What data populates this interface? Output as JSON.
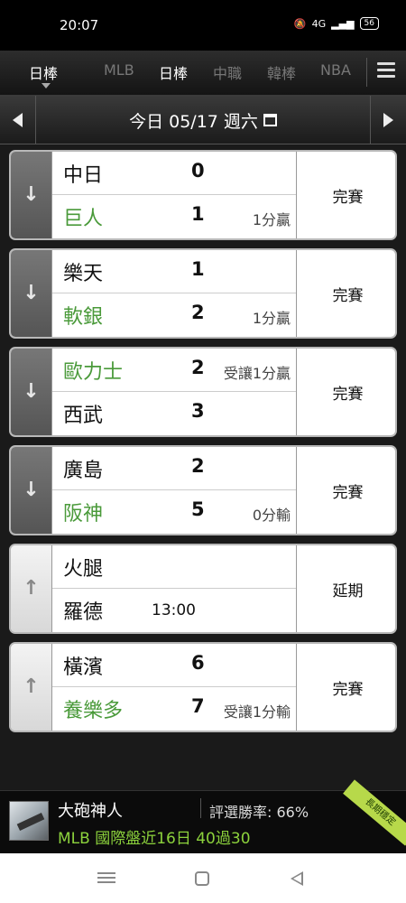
{
  "status_bar": {
    "time": "20:07",
    "network": "4G",
    "battery": "56"
  },
  "league_tabs": [
    {
      "label": "日棒",
      "active": true
    },
    {
      "label": "MLB",
      "active": false
    },
    {
      "label": "日棒",
      "active": false
    },
    {
      "label": "中職",
      "active": false
    },
    {
      "label": "韓棒",
      "active": false
    },
    {
      "label": "NBA",
      "active": false
    }
  ],
  "date_bar": {
    "label": "今日 05/17 週六"
  },
  "games": [
    {
      "arrow": "down",
      "status": "完賽",
      "away": {
        "name": "中日",
        "score": "0",
        "result": "",
        "highlight": false
      },
      "home": {
        "name": "巨人",
        "score": "1",
        "result": "1分贏",
        "highlight": true
      }
    },
    {
      "arrow": "down",
      "status": "完賽",
      "away": {
        "name": "樂天",
        "score": "1",
        "result": "",
        "highlight": false
      },
      "home": {
        "name": "軟銀",
        "score": "2",
        "result": "1分贏",
        "highlight": true
      }
    },
    {
      "arrow": "down",
      "status": "完賽",
      "away": {
        "name": "歐力士",
        "score": "2",
        "result": "受讓1分贏",
        "highlight": true
      },
      "home": {
        "name": "西武",
        "score": "3",
        "result": "",
        "highlight": false
      }
    },
    {
      "arrow": "down",
      "status": "完賽",
      "away": {
        "name": "廣島",
        "score": "2",
        "result": "",
        "highlight": false
      },
      "home": {
        "name": "阪神",
        "score": "5",
        "result": "0分輸",
        "highlight": true
      }
    },
    {
      "arrow": "up",
      "status": "延期",
      "away": {
        "name": "火腿",
        "score": "",
        "result": "",
        "highlight": false
      },
      "home": {
        "name": "羅德",
        "score": "",
        "result": "",
        "time": "13:00",
        "highlight": false
      }
    },
    {
      "arrow": "up",
      "status": "完賽",
      "away": {
        "name": "橫濱",
        "score": "6",
        "result": "",
        "highlight": false
      },
      "home": {
        "name": "養樂多",
        "score": "7",
        "result": "受讓1分輸",
        "highlight": true
      }
    }
  ],
  "banner": {
    "name": "大砲神人",
    "win_rate": "評選勝率: 66%",
    "record": "MLB 國際盤近16日 40過30",
    "ribbon": "長期穩定"
  },
  "colors": {
    "highlight_green": "#4a9a3a",
    "banner_green": "#8cd23c"
  }
}
